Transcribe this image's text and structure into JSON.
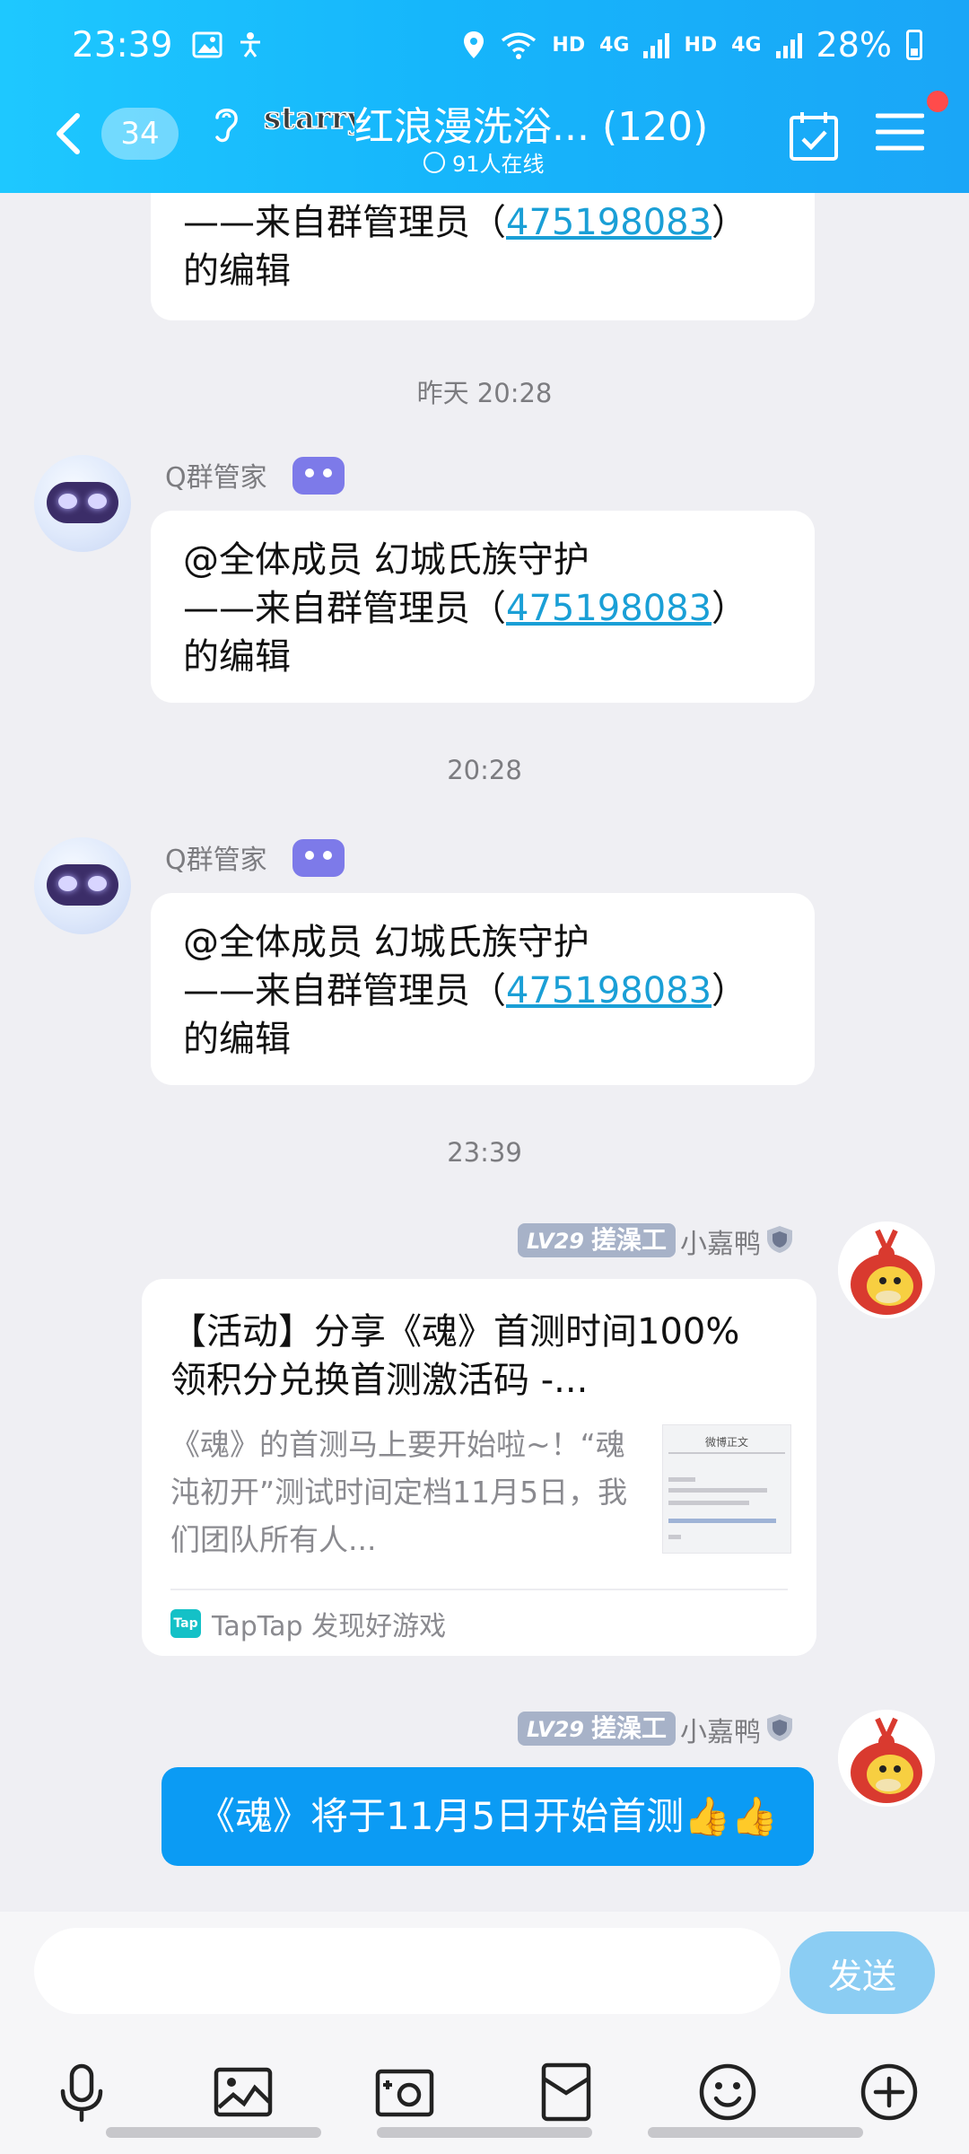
{
  "status": {
    "time": "23:39",
    "hd1": "HD",
    "net1": "4G",
    "hd2": "HD",
    "net2": "4G",
    "battery": "28%"
  },
  "header": {
    "unread_count": "34",
    "logo_text": "starry",
    "title": "红浪漫洗浴... (120)",
    "online": "91人在线"
  },
  "messages": {
    "partial_line2_prefix": "——来自群管理员（",
    "partial_admin_id": "475198083",
    "partial_line2_suffix": "）",
    "partial_line3": "的编辑",
    "ts1": "昨天 20:28",
    "bot1": {
      "sender": "Q群管家",
      "line1": "@全体成员 幻城氏族守护",
      "line2_prefix": "——来自群管理员（",
      "admin_id": "475198083",
      "line2_suffix": "）",
      "line3": "的编辑"
    },
    "ts2": "20:28",
    "bot2": {
      "sender": "Q群管家",
      "line1": "@全体成员 幻城氏族守护",
      "line2_prefix": "——来自群管理员（",
      "admin_id": "475198083",
      "line2_suffix": "）",
      "line3": "的编辑"
    },
    "ts3": "23:39",
    "user_msg1": {
      "level": "LV29",
      "title_badge": "搓澡工",
      "nick": "小嘉鸭",
      "card_title": "【活动】分享《魂》首测时间100%领积分兑换首测激活码 -...",
      "card_desc": "《魂》的首测马上要开始啦~！“魂沌初开”测试时间定档11月5日，我们团队所有人...",
      "thumb_title": "微博正文",
      "source_logo": "Tap",
      "source": "TapTap 发现好游戏"
    },
    "user_msg2": {
      "level": "LV29",
      "title_badge": "搓澡工",
      "nick": "小嘉鸭",
      "text": "《魂》将于11月5日开始首测👍👍"
    }
  },
  "input": {
    "placeholder": "",
    "send_label": "发送"
  },
  "toolbar": [
    "microphone-icon",
    "image-icon",
    "camera-icon",
    "red-packet-icon",
    "emoji-icon",
    "plus-icon"
  ]
}
